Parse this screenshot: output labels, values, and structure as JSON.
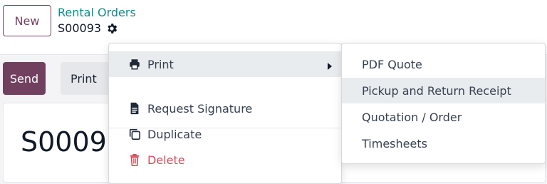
{
  "header": {
    "new_label": "New",
    "breadcrumb_parent": "Rental Orders",
    "record_id": "S00093"
  },
  "statusbar": {
    "send_label": "Send",
    "print_label": "Print"
  },
  "sheet": {
    "title": "S0009"
  },
  "action_menu": {
    "items": [
      {
        "label": "Print",
        "icon": "print-icon"
      },
      {
        "label": "Request Signature",
        "icon": "file-icon"
      },
      {
        "label": "Duplicate",
        "icon": "duplicate-icon"
      },
      {
        "label": "Delete",
        "icon": "trash-icon"
      }
    ]
  },
  "print_submenu": {
    "items": [
      {
        "label": "PDF Quote"
      },
      {
        "label": "Pickup and Return Receipt"
      },
      {
        "label": "Quotation / Order"
      },
      {
        "label": "Timesheets"
      }
    ]
  },
  "colors": {
    "brand": "#71405f",
    "link": "#0f8b8d",
    "delete": "#d44c59",
    "hover": "#e9ecef"
  }
}
